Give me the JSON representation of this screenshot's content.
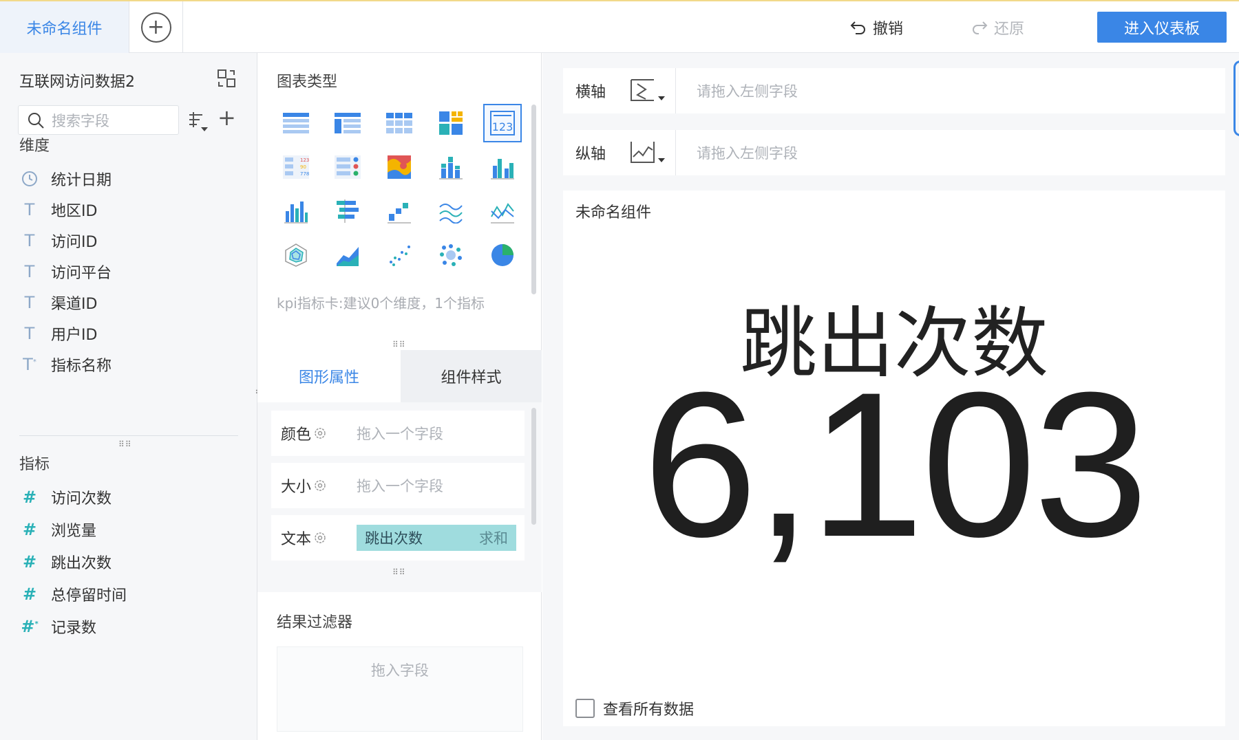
{
  "topbar": {
    "tab_label": "未命名组件",
    "undo_label": "撤销",
    "redo_label": "还原",
    "enter_label": "进入仪表板"
  },
  "left": {
    "dataset_name": "互联网访问数据2",
    "search_placeholder": "搜索字段",
    "dimension_title": "维度",
    "dimensions": [
      {
        "icon": "clock-icon",
        "label": "统计日期"
      },
      {
        "icon": "text-type-icon",
        "label": "地区ID"
      },
      {
        "icon": "text-type-icon",
        "label": "访问ID"
      },
      {
        "icon": "text-type-icon",
        "label": "访问平台"
      },
      {
        "icon": "text-type-icon",
        "label": "渠道ID"
      },
      {
        "icon": "text-type-icon",
        "label": "用户ID"
      },
      {
        "icon": "text-calc-icon",
        "label": "指标名称"
      }
    ],
    "measure_title": "指标",
    "measures": [
      {
        "icon": "number-type-icon",
        "label": "访问次数"
      },
      {
        "icon": "number-type-icon",
        "label": "浏览量"
      },
      {
        "icon": "number-type-icon",
        "label": "跳出次数"
      },
      {
        "icon": "number-type-icon",
        "label": "总停留时间"
      },
      {
        "icon": "number-calc-icon",
        "label": "记录数"
      }
    ]
  },
  "middle": {
    "chart_type_title": "图表类型",
    "chart_hint": "kpi指标卡:建议0个维度，1个指标",
    "tab_graph": "图形属性",
    "tab_style": "组件样式",
    "prop_color": "颜色",
    "prop_size": "大小",
    "prop_text": "文本",
    "drop_placeholder": "拖入一个字段",
    "text_field": "跳出次数",
    "text_agg": "求和",
    "filter_title": "结果过滤器",
    "filter_placeholder": "拖入字段"
  },
  "right": {
    "x_axis_label": "横轴",
    "y_axis_label": "纵轴",
    "axis_placeholder": "请拖入左侧字段",
    "component_title": "未命名组件",
    "kpi_label": "跳出次数",
    "kpi_value": "6,103",
    "view_all_label": "查看所有数据"
  },
  "colors": {
    "accent": "#3a86e6",
    "pill": "#9fdcde",
    "measure_icon": "#2ab1b7"
  }
}
